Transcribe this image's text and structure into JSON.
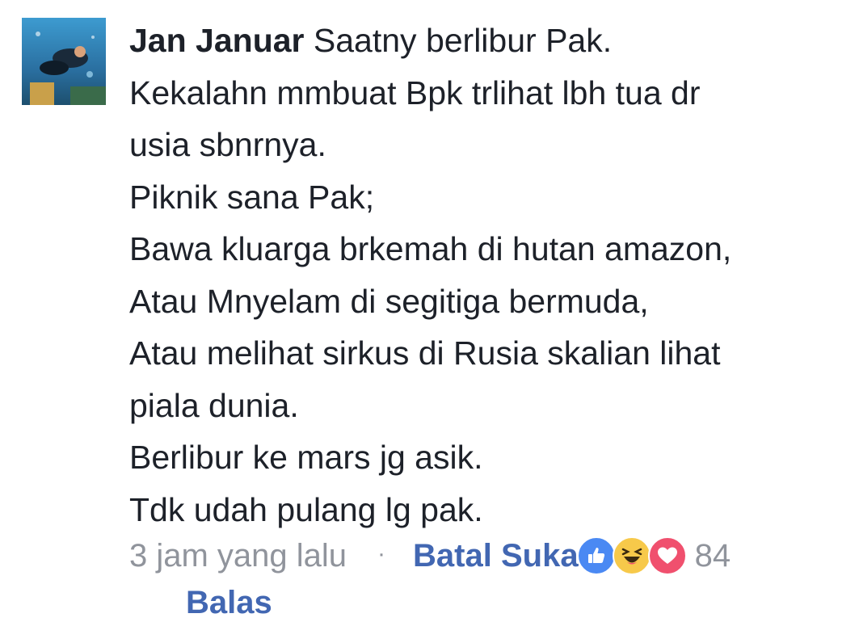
{
  "comment": {
    "author": "Jan Januar",
    "lines": [
      "Saatny berlibur Pak.",
      "Kekalahn mmbuat Bpk trlihat lbh tua dr",
      "usia sbnrnya.",
      "Piknik sana Pak;",
      "Bawa kluarga brkemah di hutan amazon,",
      "Atau Mnyelam di segitiga bermuda,",
      "Atau melihat sirkus di Rusia skalian lihat",
      "piala dunia.",
      "Berlibur ke mars jg asik.",
      "Tdk udah pulang lg pak."
    ]
  },
  "footer": {
    "timestamp": "3 jam yang lalu",
    "separator": "·",
    "unlike_label": "Batal Suka",
    "reaction_icons": [
      "like-icon",
      "haha-icon",
      "love-icon"
    ],
    "reaction_count": "84",
    "reply_label": "Balas"
  },
  "colors": {
    "text": "#1d2129",
    "meta": "#90949c",
    "link": "#4267b2",
    "like": "#4a89f3",
    "haha": "#f7c94a",
    "love": "#f0506e"
  }
}
